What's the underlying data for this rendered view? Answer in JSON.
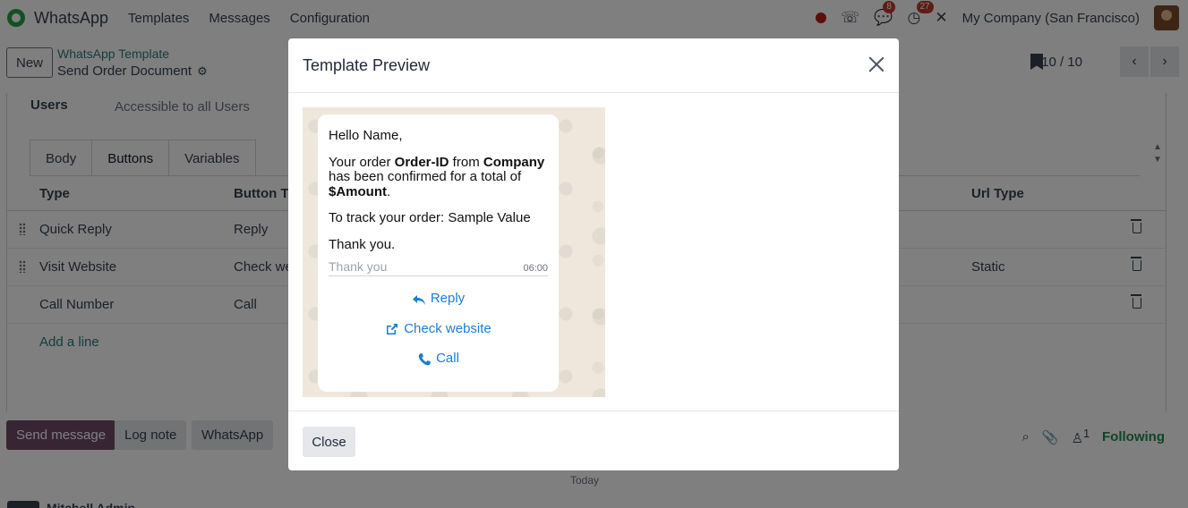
{
  "navbar": {
    "app_name": "WhatsApp",
    "menu": [
      "Templates",
      "Messages",
      "Configuration"
    ],
    "messages_badge": "8",
    "activity_badge": "27",
    "company": "My Company (San Francisco)"
  },
  "control": {
    "new_label": "New",
    "breadcrumb_parent": "WhatsApp Template",
    "breadcrumb_current": "Send Order Document",
    "pager": "10 / 10"
  },
  "form": {
    "users_label": "Users",
    "users_value": "Accessible to all Users",
    "tabs": [
      "Body",
      "Buttons",
      "Variables"
    ],
    "columns": {
      "type": "Type",
      "button_text": "Button Te",
      "url_type": "Url Type"
    },
    "rows": [
      {
        "type": "Quick Reply",
        "text": "Reply",
        "url_type": ""
      },
      {
        "type": "Visit Website",
        "text": "Check we",
        "url_type": "Static"
      },
      {
        "type": "Call Number",
        "text": "Call",
        "url_type": ""
      }
    ],
    "add_line": "Add a line"
  },
  "chatter": {
    "send_message": "Send message",
    "log_note": "Log note",
    "whatsapp": "WhatsApp",
    "followers_count": "1",
    "following": "Following",
    "today": "Today",
    "author": "Mitchell Admin"
  },
  "modal": {
    "title": "Template Preview",
    "greeting": "Hello Name,",
    "order_pre": "Your order ",
    "order_id": "Order-ID",
    "order_mid": " from ",
    "company": "Company",
    "order_post": " has been confirmed for a total of ",
    "amount": "$Amount",
    "amount_end": ".",
    "track": "To track your order: Sample Value",
    "thanks": "Thank you.",
    "footer": "Thank you",
    "time": "06:00",
    "buttons": [
      "Reply",
      "Check website",
      "Call"
    ],
    "close_label": "Close",
    "link_color": "#1a7dd7"
  }
}
